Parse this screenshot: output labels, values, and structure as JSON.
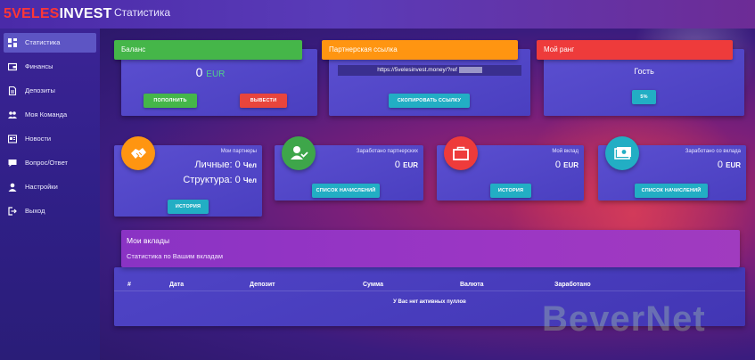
{
  "brand": {
    "part1": "5VELES",
    "part2": "INVEST"
  },
  "header": {
    "title": "Статистика"
  },
  "sidebar": {
    "items": [
      {
        "label": "Статистика",
        "icon": "dashboard-icon",
        "active": true
      },
      {
        "label": "Финансы",
        "icon": "wallet-icon"
      },
      {
        "label": "Депозиты",
        "icon": "document-icon"
      },
      {
        "label": "Моя Команда",
        "icon": "team-icon"
      },
      {
        "label": "Новости",
        "icon": "news-icon"
      },
      {
        "label": "Вопрос/Ответ",
        "icon": "chat-icon"
      },
      {
        "label": "Настройки",
        "icon": "user-icon"
      },
      {
        "label": "Выход",
        "icon": "logout-icon"
      }
    ]
  },
  "balance": {
    "title": "Баланс",
    "amount": "0",
    "currency": "EUR",
    "deposit_btn": "ПОПОЛНИТЬ",
    "withdraw_btn": "ВЫВЕСТИ"
  },
  "referral": {
    "title": "Партнерская ссылка",
    "link": "https://5velesinvest.money/?ref",
    "copy_btn": "СКОПИРОВАТЬ ССЫЛКУ"
  },
  "rank": {
    "title": "Мой ранг",
    "value": "Гость",
    "percent_btn": "5%"
  },
  "partners": {
    "caption": "Мои партнеры",
    "personal_label": "Личные:",
    "personal_value": "0",
    "structure_label": "Структура:",
    "structure_value": "0",
    "unit": "Чел",
    "history_btn": "ИСТОРИЯ"
  },
  "partner_earnings": {
    "caption": "Заработано партнерских",
    "value": "0",
    "currency": "EUR",
    "btn": "СПИСОК НАЧИСЛЕНИЙ"
  },
  "my_deposit": {
    "caption": "Мой вклад",
    "value": "0",
    "currency": "EUR",
    "btn": "ИСТОРИЯ"
  },
  "deposit_earnings": {
    "caption": "Заработано со вклада",
    "value": "0",
    "currency": "EUR",
    "btn": "СПИСОК НАЧИСЛЕНИЙ"
  },
  "deposits_panel": {
    "title": "Мои вклады",
    "subtitle": "Статистика по Вашим вкладам",
    "columns": [
      "#",
      "Дата",
      "Депозит",
      "Сумма",
      "Валюта",
      "Заработано"
    ],
    "empty": "У Вас нет активных пуллов"
  },
  "watermark": "BeverNet",
  "colors": {
    "green": "#45b649",
    "orange": "#ff9511",
    "red": "#ee3b3b",
    "teal": "#22aec4",
    "purple_head": "#9b36c4"
  }
}
